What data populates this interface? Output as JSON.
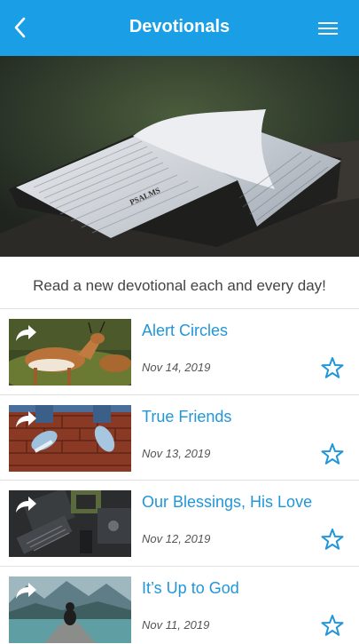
{
  "header": {
    "title": "Devotionals",
    "back_icon": "chevron-left-icon",
    "menu_icon": "hamburger-menu-icon",
    "background_color": "#1a9fe6"
  },
  "hero": {
    "image": "open-bible-photo",
    "page_heading": "PSALMS"
  },
  "tagline": "Read a new devotional each and every day!",
  "accent_color": "#2196d9",
  "devotionals": [
    {
      "title": "Alert Circles",
      "date": "Nov 14, 2019",
      "image": "deer-photo"
    },
    {
      "title": "True Friends",
      "date": "Nov 13, 2019",
      "image": "sneakers-on-brick-wall-photo"
    },
    {
      "title": "Our Blessings, His Love",
      "date": "Nov 12, 2019",
      "image": "circuit-board-photo"
    },
    {
      "title": "It’s Up to God",
      "date": "Nov 11, 2019",
      "image": "person-on-dock-mountain-lake-photo"
    }
  ]
}
